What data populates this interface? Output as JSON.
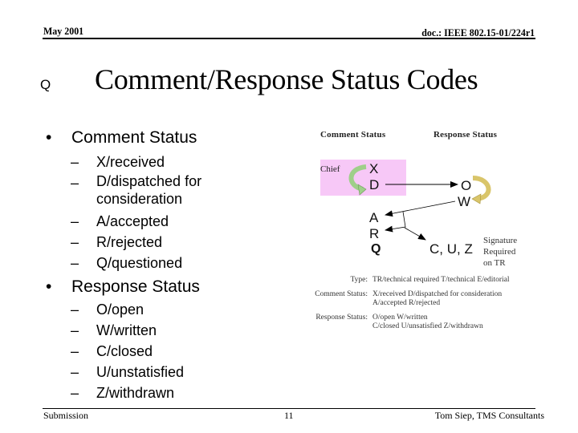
{
  "header": {
    "date": "May 2001",
    "doc_id": "doc.: IEEE 802.15-01/224r1"
  },
  "title": {
    "marker": "Q",
    "text": "Comment/Response Status Codes"
  },
  "comment_status": {
    "bullet": "•",
    "label": "Comment Status",
    "items": [
      "X/received",
      "D/dispatched for consideration",
      "A/accepted",
      "R/rejected",
      "Q/questioned"
    ]
  },
  "response_status": {
    "bullet": "•",
    "label": "Response Status",
    "items": [
      "O/open",
      "W/written",
      "C/closed",
      "U/unstatisfied",
      "Z/withdrawn"
    ]
  },
  "diagram": {
    "comment_status_heading": "Comment Status",
    "response_status_heading": "Response Status",
    "chief_label": "Chief",
    "letters": {
      "x": "X",
      "d": "D",
      "o": "O",
      "w": "W",
      "a": "A",
      "r": "R",
      "q": "Q",
      "cuz": "C, U, Z"
    },
    "signature_note": [
      "Signature",
      "Required",
      "on TR"
    ],
    "colors": {
      "chief_box": "#f7c8f7",
      "chief_arrow": "#9fcf8a",
      "writer_arrow": "#d9c56a"
    }
  },
  "legend": {
    "rows": [
      {
        "key": "Type:",
        "lines": [
          "TR/technical required  T/technical  E/editorial"
        ]
      },
      {
        "key": "Comment Status:",
        "lines": [
          "X/received  D/dispatched for consideration",
          "A/accepted  R/rejected"
        ]
      },
      {
        "key": "Response Status:",
        "lines": [
          "O/open   W/written",
          "C/closed  U/unsatisfied  Z/withdrawn"
        ]
      }
    ]
  },
  "footer": {
    "left": "Submission",
    "page": "11",
    "right": "Tom Siep, TMS Consultants"
  }
}
